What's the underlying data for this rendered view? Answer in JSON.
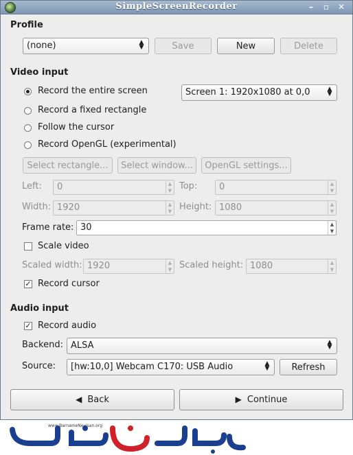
{
  "window": {
    "title": "SimpleScreenRecorder"
  },
  "profile": {
    "heading": "Profile",
    "selected": "(none)",
    "save_label": "Save",
    "new_label": "New",
    "delete_label": "Delete"
  },
  "video": {
    "heading": "Video input",
    "radios": [
      "Record the entire screen",
      "Record a fixed rectangle",
      "Follow the cursor",
      "Record OpenGL (experimental)"
    ],
    "screen_selected": "Screen 1: 1920x1080 at 0,0",
    "select_rect_label": "Select rectangle...",
    "select_window_label": "Select window...",
    "opengl_settings_label": "OpenGL settings...",
    "left_label": "Left:",
    "left_value": "0",
    "top_label": "Top:",
    "top_value": "0",
    "width_label": "Width:",
    "width_value": "1920",
    "height_label": "Height:",
    "height_value": "1080",
    "framerate_label": "Frame rate:",
    "framerate_value": "30",
    "scale_label": "Scale video",
    "scaled_width_label": "Scaled width:",
    "scaled_width_value": "1920",
    "scaled_height_label": "Scaled height:",
    "scaled_height_value": "1080",
    "record_cursor_label": "Record cursor"
  },
  "audio": {
    "heading": "Audio input",
    "record_audio_label": "Record audio",
    "backend_label": "Backend:",
    "backend_value": "ALSA",
    "source_label": "Source:",
    "source_value": "[hw:10,0] Webcam C170: USB Audio",
    "refresh_label": "Refresh"
  },
  "nav": {
    "back_label": "Back",
    "continue_label": "Continue"
  },
  "watermark": {
    "url": "www.BarnameNevisan.org"
  },
  "colors": {
    "titlebar": "#8aa0bb",
    "logo_blue": "#1a3f8f",
    "logo_red": "#d0202a"
  }
}
